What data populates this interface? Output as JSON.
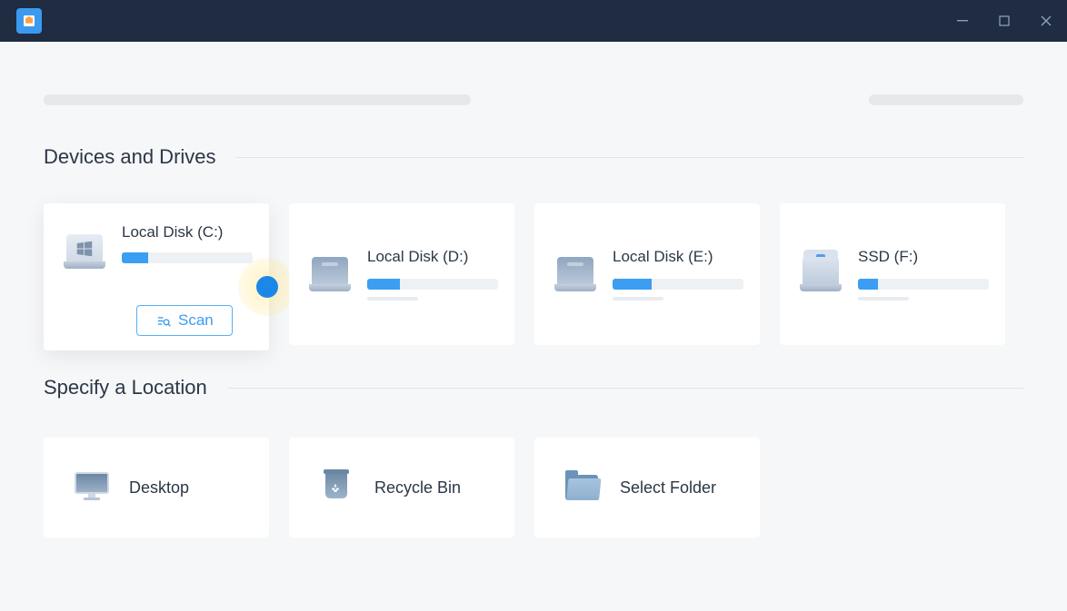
{
  "sections": {
    "drives_title": "Devices and Drives",
    "location_title": "Specify a Location"
  },
  "drives": [
    {
      "name": "Local Disk (C:)",
      "usage_percent": 20,
      "selected": true
    },
    {
      "name": "Local Disk (D:)",
      "usage_percent": 25,
      "selected": false
    },
    {
      "name": "Local Disk (E:)",
      "usage_percent": 30,
      "selected": false
    },
    {
      "name": "SSD (F:)",
      "usage_percent": 15,
      "selected": false
    }
  ],
  "scan_button_label": "Scan",
  "locations": [
    {
      "name": "Desktop"
    },
    {
      "name": "Recycle Bin"
    },
    {
      "name": "Select Folder"
    }
  ]
}
